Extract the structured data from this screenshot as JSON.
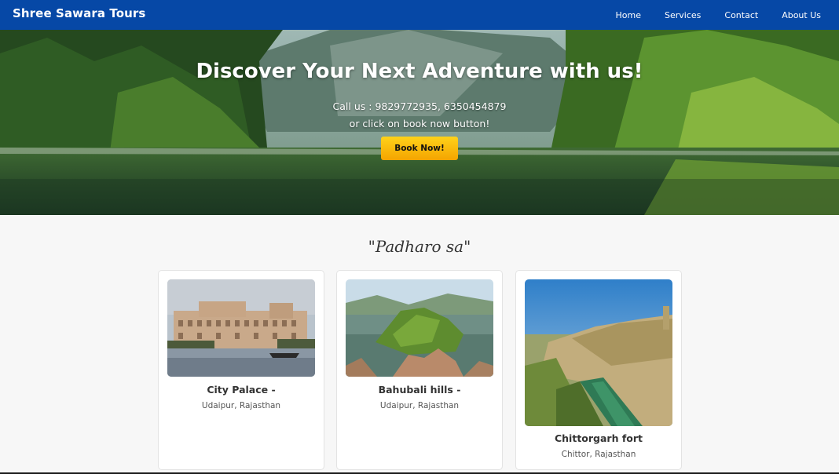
{
  "header": {
    "brand": "Shree Sawara Tours",
    "nav": [
      {
        "label": "Home"
      },
      {
        "label": "Services"
      },
      {
        "label": "Contact"
      },
      {
        "label": "About Us"
      }
    ],
    "background_color": "#0648a6"
  },
  "hero": {
    "title": "Discover Your Next Adventure with us!",
    "call_line": "Call us : 9829772935, 6350454879",
    "sub_line": "or click on book now button!",
    "book_label": "Book Now!",
    "button_color": "#ffc107"
  },
  "welcome": {
    "text": "\"Padharo sa\""
  },
  "places": [
    {
      "title": "City Palace -",
      "location": "Udaipur, Rajasthan",
      "icon": "city-palace-photo"
    },
    {
      "title": "Bahubali hills -",
      "location": "Udaipur, Rajasthan",
      "icon": "bahubali-hills-photo"
    },
    {
      "title": "Chittorgarh fort",
      "location": "Chittor, Rajasthan",
      "icon": "chittorgarh-fort-photo"
    }
  ]
}
